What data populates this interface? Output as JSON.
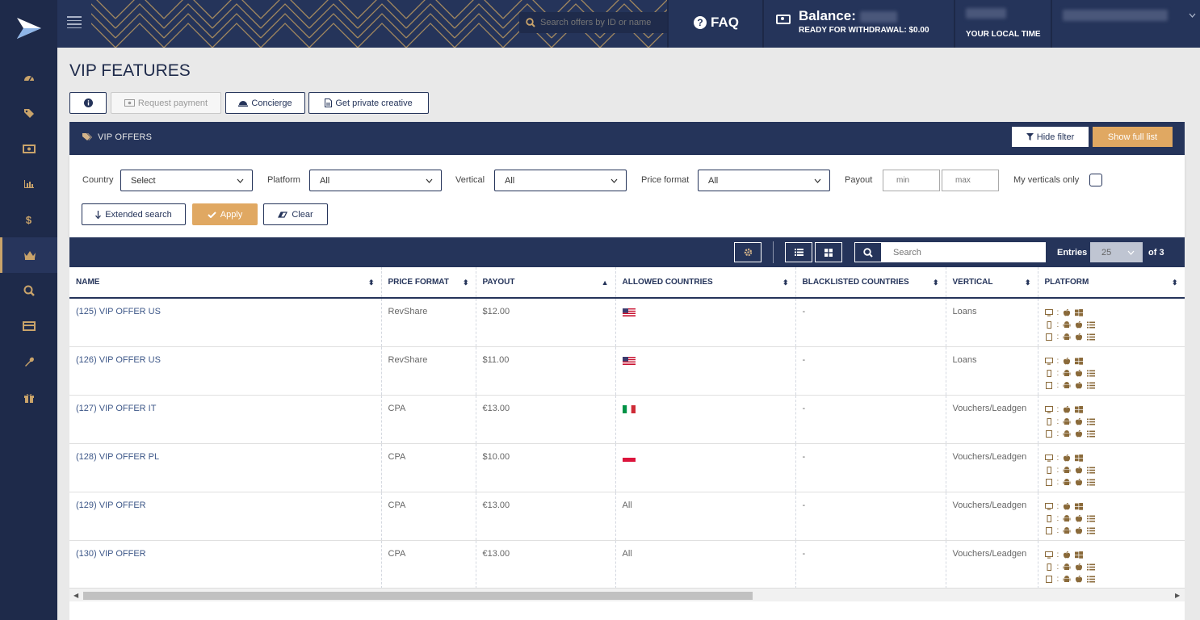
{
  "header": {
    "search_placeholder": "Search offers by ID or name",
    "faq_label": "FAQ",
    "balance_label": "Balance:",
    "ready_label": "READY FOR WITHDRAWAL: $0.00",
    "local_time_label": "YOUR LOCAL TIME"
  },
  "sidebar": {
    "items": [
      {
        "icon": "dashboard-icon"
      },
      {
        "icon": "tags-icon"
      },
      {
        "icon": "money-icon"
      },
      {
        "icon": "bar-chart-icon"
      },
      {
        "icon": "dollar-icon",
        "label": "$"
      },
      {
        "icon": "crown-icon",
        "active": true
      },
      {
        "icon": "search-zoom-icon"
      },
      {
        "icon": "credit-card-icon"
      },
      {
        "icon": "wrench-icon"
      },
      {
        "icon": "gift-icon"
      }
    ]
  },
  "page": {
    "title": "VIP FEATURES",
    "buttons": {
      "request_payment": "Request payment",
      "concierge": "Concierge",
      "private_creative": "Get private creative"
    }
  },
  "panel": {
    "title": "VIP OFFERS",
    "hide_filter": "Hide filter",
    "show_full_list": "Show full list"
  },
  "filter": {
    "country_label": "Country",
    "country_value": "Select",
    "platform_label": "Platform",
    "platform_value": "All",
    "vertical_label": "Vertical",
    "vertical_value": "All",
    "price_format_label": "Price format",
    "price_format_value": "All",
    "payout_label": "Payout",
    "payout_min_placeholder": "min",
    "payout_max_placeholder": "max",
    "my_verticals_label": "My verticals only",
    "extended_search": "Extended search",
    "apply": "Apply",
    "clear": "Clear"
  },
  "toolbar": {
    "search_placeholder": "Search",
    "entries_label": "Entries",
    "entries_value": "25",
    "of_label": "of 3"
  },
  "table": {
    "columns": [
      "NAME",
      "PRICE FORMAT",
      "PAYOUT",
      "ALLOWED COUNTRIES",
      "BLACKLISTED COUNTRIES",
      "VERTICAL",
      "PLATFORM"
    ],
    "rows": [
      {
        "name": "(125) VIP OFFER US",
        "price_format": "RevShare",
        "payout": "$12.00",
        "flag": "us",
        "allowed": "",
        "blacklisted": "-",
        "vertical": "Loans"
      },
      {
        "name": "(126) VIP OFFER US",
        "price_format": "RevShare",
        "payout": "$11.00",
        "flag": "us",
        "allowed": "",
        "blacklisted": "-",
        "vertical": "Loans"
      },
      {
        "name": "(127) VIP OFFER IT",
        "price_format": "CPA",
        "payout": "€13.00",
        "flag": "it",
        "allowed": "",
        "blacklisted": "-",
        "vertical": "Vouchers/Leadgen"
      },
      {
        "name": "(128) VIP OFFER PL",
        "price_format": "CPA",
        "payout": "$10.00",
        "flag": "pl",
        "allowed": "",
        "blacklisted": "-",
        "vertical": "Vouchers/Leadgen"
      },
      {
        "name": "(129) VIP OFFER",
        "price_format": "CPA",
        "payout": "€13.00",
        "flag": "",
        "allowed": "All",
        "blacklisted": "-",
        "vertical": "Vouchers/Leadgen"
      },
      {
        "name": "(130) VIP OFFER",
        "price_format": "CPA",
        "payout": "€13.00",
        "flag": "",
        "allowed": "All",
        "blacklisted": "-",
        "vertical": "Vouchers/Leadgen"
      }
    ]
  },
  "colors": {
    "navy": "#25345a",
    "sidebar": "#1e2a4a",
    "gold": "#e0a862",
    "link": "#3d5788"
  }
}
